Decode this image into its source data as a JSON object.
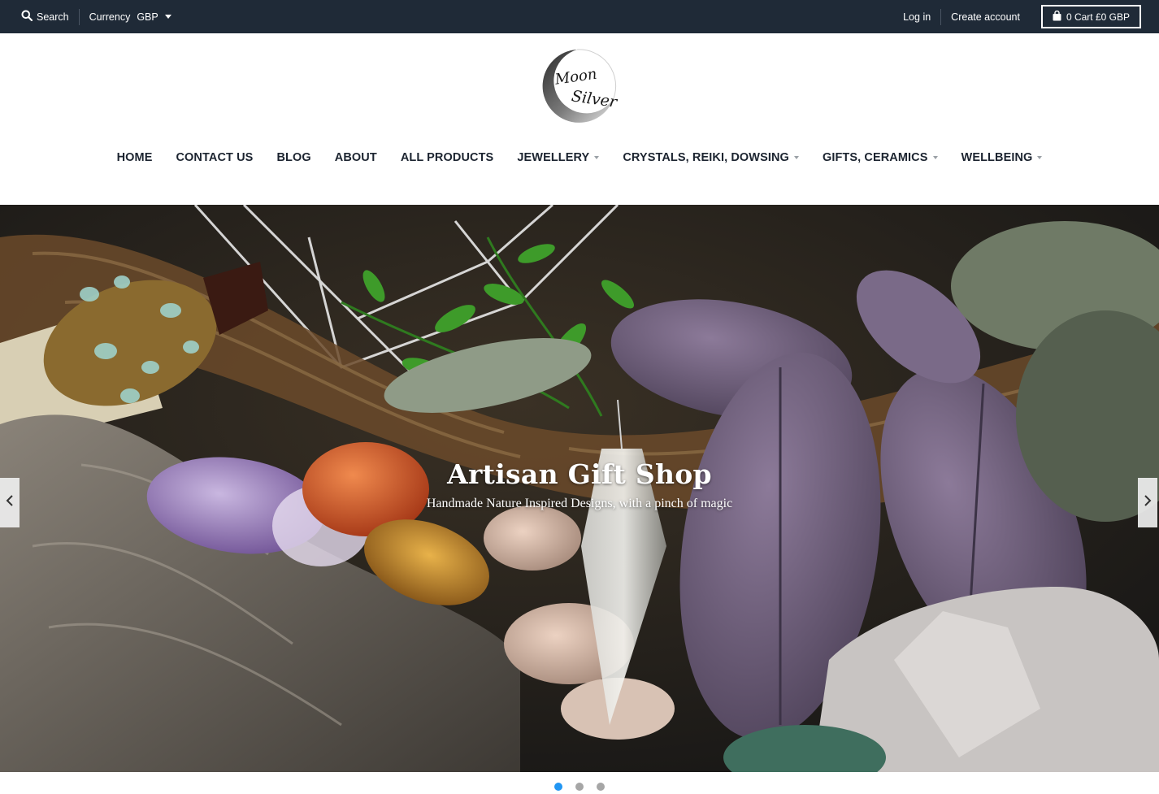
{
  "topbar": {
    "search_label": "Search",
    "currency_label": "Currency",
    "currency_value": "GBP",
    "login_label": "Log in",
    "create_account_label": "Create account",
    "cart_label": "0 Cart £0 GBP"
  },
  "logo": {
    "line1": "Moon",
    "line2": "Silver"
  },
  "nav": {
    "items": [
      {
        "label": "HOME"
      },
      {
        "label": "CONTACT US"
      },
      {
        "label": "BLOG"
      },
      {
        "label": "ABOUT"
      },
      {
        "label": "ALL PRODUCTS"
      },
      {
        "label": "JEWELLERY",
        "dropdown": true
      },
      {
        "label": "CRYSTALS, REIKI, DOWSING",
        "dropdown": true
      },
      {
        "label": "GIFTS, CERAMICS",
        "dropdown": true
      },
      {
        "label": "WELLBEING",
        "dropdown": true
      }
    ]
  },
  "hero": {
    "title": "Artisan Gift Shop",
    "subtitle": "Handmade Nature Inspired Designs, with a pinch of magic",
    "active_slide": 1,
    "slide_count": 3
  },
  "icons": {
    "search": "search-icon",
    "cart": "shopping-bag-icon",
    "prev": "chevron-left-icon",
    "next": "chevron-right-icon"
  },
  "colors": {
    "topbar_bg": "#1f2a37",
    "text_dark": "#1c2430",
    "dot_active": "#2196f3",
    "dot_inactive": "#a6a6a6"
  }
}
